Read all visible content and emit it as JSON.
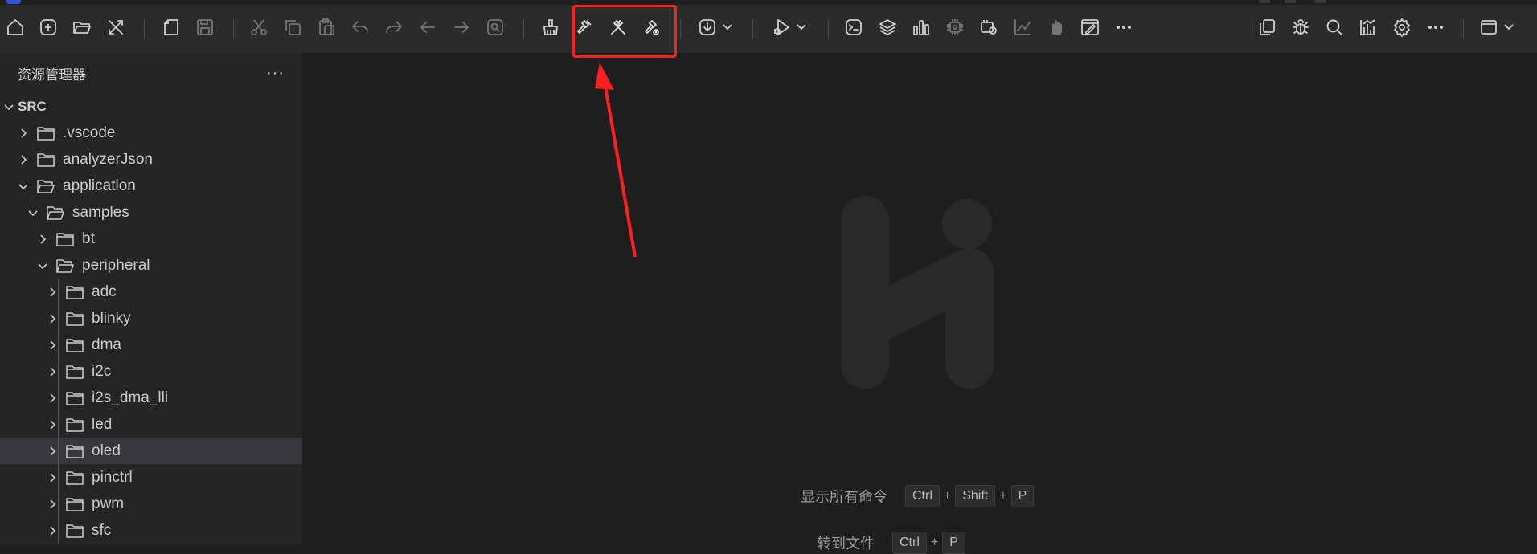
{
  "colors": {
    "toolbar_bg": "#2b2b2b",
    "sidebar_bg": "#252526",
    "editor_bg": "#1e1e1e",
    "selected_row": "#37373d",
    "annotation_red": "#ff1f1f"
  },
  "toolbar": {
    "icons": [
      "home-icon",
      "new-file-icon",
      "open-folder-icon",
      "tools-icon",
      "new-document-icon",
      "save-icon",
      "cut-icon",
      "copy-icon",
      "paste-icon",
      "undo-icon",
      "redo-icon",
      "back-icon",
      "forward-icon",
      "find-icon",
      "clean-icon",
      "build-icon",
      "rebuild-icon",
      "build-file-icon",
      "download-icon",
      "debug-run-icon",
      "terminal-icon",
      "layers-icon",
      "chart-bars-icon",
      "chip-icon",
      "settings-chip-icon",
      "line-chart-icon",
      "hand-icon",
      "window-edit-icon",
      "more-icon",
      "copy-pages-icon",
      "bug-icon",
      "search-icon",
      "stats-icon",
      "gear-icon",
      "more-icon",
      "layout-icon"
    ]
  },
  "sidebar": {
    "title": "资源管理器",
    "more": "···",
    "tree": [
      {
        "label": "SRC",
        "expanded": true
      },
      {
        "label": ".vscode",
        "expanded": false
      },
      {
        "label": "analyzerJson",
        "expanded": false
      },
      {
        "label": "application",
        "expanded": true
      },
      {
        "label": "samples",
        "expanded": true
      },
      {
        "label": "bt",
        "expanded": false
      },
      {
        "label": "peripheral",
        "expanded": true
      },
      {
        "label": "adc",
        "expanded": false
      },
      {
        "label": "blinky",
        "expanded": false
      },
      {
        "label": "dma",
        "expanded": false
      },
      {
        "label": "i2c",
        "expanded": false
      },
      {
        "label": "i2s_dma_lli",
        "expanded": false
      },
      {
        "label": "led",
        "expanded": false
      },
      {
        "label": "oled",
        "expanded": false,
        "selected": true
      },
      {
        "label": "pinctrl",
        "expanded": false
      },
      {
        "label": "pwm",
        "expanded": false
      },
      {
        "label": "sfc",
        "expanded": false
      }
    ]
  },
  "editor": {
    "commands": [
      {
        "label": "显示所有命令",
        "keys": [
          "Ctrl",
          "Shift",
          "P"
        ],
        "sep": "+"
      },
      {
        "label": "转到文件",
        "keys": [
          "Ctrl",
          "P"
        ],
        "sep": "+"
      }
    ]
  }
}
